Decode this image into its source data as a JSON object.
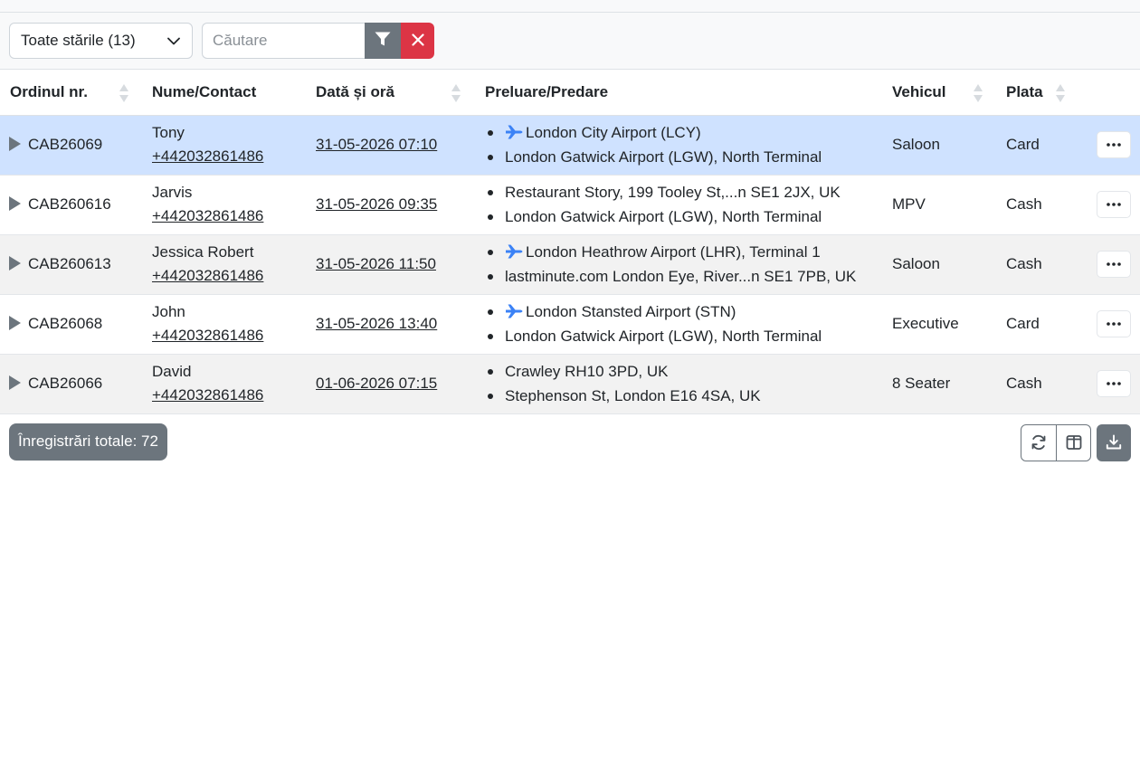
{
  "toolbar": {
    "status_filter": "Toate stările (13)",
    "search_placeholder": "Căutare"
  },
  "table": {
    "columns": [
      "Ordinul nr.",
      "Nume/Contact",
      "Dată și oră",
      "Preluare/Predare",
      "Vehicul",
      "Plata"
    ],
    "rows": [
      {
        "order": "CAB26069",
        "name": "Tony",
        "phone": "+442032861486",
        "datetime": "31-05-2026 07:10",
        "pickup": "London City Airport (LCY)",
        "pickup_airport": true,
        "dropoff": "London Gatwick Airport (LGW), North Terminal",
        "vehicle": "Saloon",
        "payment": "Card"
      },
      {
        "order": "CAB260616",
        "name": "Jarvis",
        "phone": "+442032861486",
        "datetime": "31-05-2026 09:35",
        "pickup": "Restaurant Story, 199 Tooley St,...n SE1 2JX, UK",
        "pickup_airport": false,
        "dropoff": "London Gatwick Airport (LGW), North Terminal",
        "vehicle": "MPV",
        "payment": "Cash"
      },
      {
        "order": "CAB260613",
        "name": "Jessica Robert",
        "phone": "+442032861486",
        "datetime": "31-05-2026 11:50",
        "pickup": "London Heathrow Airport (LHR), Terminal 1",
        "pickup_airport": true,
        "dropoff": "lastminute.com London Eye, River...n SE1 7PB, UK",
        "vehicle": "Saloon",
        "payment": "Cash"
      },
      {
        "order": "CAB26068",
        "name": "John",
        "phone": "+442032861486",
        "datetime": "31-05-2026 13:40",
        "pickup": "London Stansted Airport (STN)",
        "pickup_airport": true,
        "dropoff": "London Gatwick Airport (LGW), North Terminal",
        "vehicle": "Executive",
        "payment": "Card"
      },
      {
        "order": "CAB26066",
        "name": "David",
        "phone": "+442032861486",
        "datetime": "01-06-2026 07:15",
        "pickup": "Crawley RH10 3PD, UK",
        "pickup_airport": false,
        "dropoff": "Stephenson St, London E16 4SA, UK",
        "vehicle": "8 Seater",
        "payment": "Cash"
      }
    ]
  },
  "footer": {
    "total": "Înregistrări totale: 72"
  },
  "icons": {
    "status_select": "chevron-down-icon",
    "filter": "filter-icon",
    "clear": "close-icon",
    "row_expand": "caret-right-icon",
    "airport": "plane-icon",
    "row_menu": "ellipsis-icon",
    "refresh": "refresh-icon",
    "columns": "columns-icon",
    "download": "download-icon"
  },
  "colors": {
    "selected_row": "#cfe2ff",
    "striped_row": "#f2f2f2",
    "filter_button": "#6c757d",
    "clear_button": "#dc3545",
    "airport_icon": "#3b82f6"
  }
}
